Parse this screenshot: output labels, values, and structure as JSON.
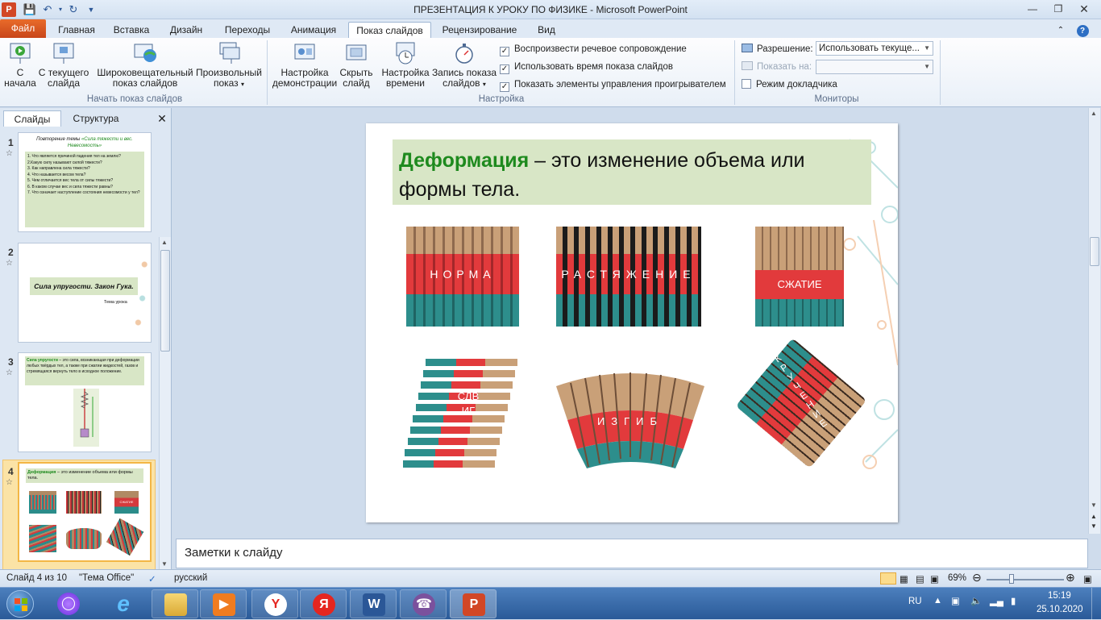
{
  "window": {
    "title": "ПРЕЗЕНТАЦИЯ К УРОКУ ПО ФИЗИКЕ  -  Microsoft PowerPoint"
  },
  "tabs": [
    "Файл",
    "Главная",
    "Вставка",
    "Дизайн",
    "Переходы",
    "Анимация",
    "Показ слайдов",
    "Рецензирование",
    "Вид"
  ],
  "active_tab": "Показ слайдов",
  "ribbon": {
    "start": {
      "from_beginning": [
        "С",
        "начала"
      ],
      "from_current": [
        "С текущего",
        "слайда"
      ],
      "broadcast": [
        "Широковещательный",
        "показ слайдов"
      ],
      "custom": [
        "Произвольный",
        "показ"
      ],
      "group_label": "Начать показ слайдов"
    },
    "setup": {
      "setup_show": [
        "Настройка",
        "демонстрации"
      ],
      "hide_slide": [
        "Скрыть",
        "слайд"
      ],
      "rehearse": [
        "Настройка",
        "времени"
      ],
      "record": [
        "Запись показа",
        "слайдов"
      ],
      "group_label": "Настройка",
      "checks": [
        {
          "label": "Воспроизвести речевое сопровождение",
          "checked": true
        },
        {
          "label": "Использовать время показа слайдов",
          "checked": true
        },
        {
          "label": "Показать элементы управления проигрывателем",
          "checked": true
        }
      ]
    },
    "monitors": {
      "resolution_label": "Разрешение:",
      "resolution_value": "Использовать текуще...",
      "show_on_label": "Показать на:",
      "presenter_view": "Режим докладчика",
      "group_label": "Мониторы"
    }
  },
  "panel": {
    "tabs": [
      "Слайды",
      "Структура"
    ]
  },
  "thumbnails": [
    {
      "num": "1",
      "title": "Повторение темы ",
      "title_hl": "«Сила тяжести и вес. Невесомость»",
      "lines": [
        "1. Что является причиной падения тел на землю?",
        "2.Какую силу называют силой тяжести?",
        "3. Как направлена сила тяжести?",
        "4. Что называется весом тела?",
        "5. Чем отличается вес тела от силы тяжести?",
        "6. В каком случае вес и сила тяжести равны?",
        "7. Что означает наступление состояния невесомости у тел?"
      ]
    },
    {
      "num": "2",
      "title": "Сила упругости. Закон Гука.",
      "subtitle": "Тема урока"
    },
    {
      "num": "3",
      "title_hl": "Сила упругости",
      "title": " – это сила, возникающая при деформации любых твёрдых тел, а также при сжатии жидкостей, газов и стремящаяся вернуть тело в исходное положение."
    },
    {
      "num": "4",
      "title_hl": "Деформация",
      "title": " – это изменение объема или формы тела."
    }
  ],
  "slide": {
    "heading_hl": "Деформация",
    "heading_rest": " – это изменение объема или формы тела.",
    "images": [
      "НОРМА",
      "РАСТЯЖЕНИЕ",
      "СЖАТИЕ",
      "СДВИГ",
      "ИЗГИБ",
      "КРУЧЕНИЕ"
    ]
  },
  "notes": {
    "placeholder": "Заметки к слайду"
  },
  "status": {
    "slide": "Слайд 4 из 10",
    "theme": "\"Тема Office\"",
    "lang": "русский",
    "zoom": "69%"
  },
  "tray": {
    "lang": "RU",
    "time": "15:19",
    "date": "25.10.2020"
  },
  "colors": {
    "accent_green": "#1e8a1e",
    "ribbon_bg": "#e9f0f8",
    "file_tab": "#d5551f",
    "slide_heading_bg": "#d8e6c6"
  }
}
